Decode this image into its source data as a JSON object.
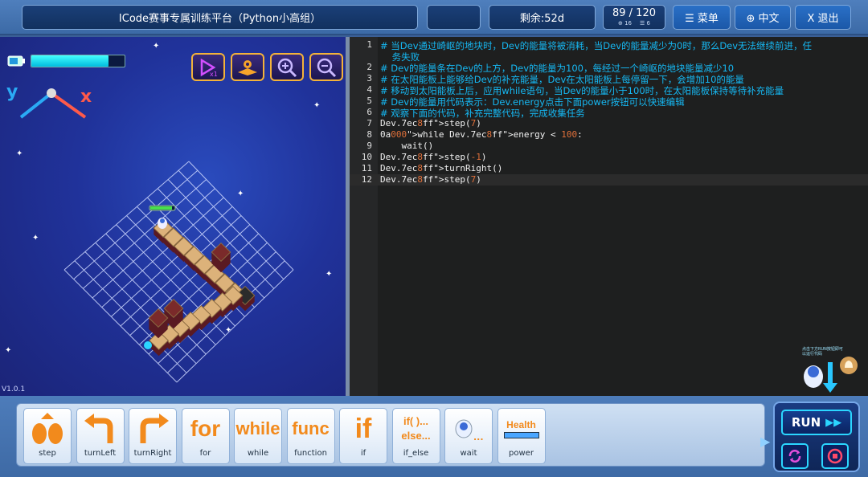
{
  "topbar": {
    "title": "ICode赛事专属训练平台（Python小高组）",
    "remaining": "剩余:52d",
    "progress_main": "89 / 120",
    "progress_sub_a": "⊕ 16",
    "progress_sub_b": "☰ 6",
    "menu_label": "☰ 菜单",
    "lang_label": "⊕ 中文",
    "exit_label": "X 退出"
  },
  "scene": {
    "version": "V1.0.1",
    "axis_y": "y",
    "axis_x": "x",
    "energy_level": 0.83,
    "buttons": [
      "reset-view-icon",
      "map-icon",
      "zoom-in-icon",
      "zoom-out-icon"
    ]
  },
  "editor": {
    "lines": [
      {
        "n": "1",
        "text": "# 当Dev通过崎岖的地块时，Dev的能量将被消耗，当Dev的能量减少为0时，那么Dev无法继续前进，任",
        "kind": "comment"
      },
      {
        "n": "",
        "text": "    务失败",
        "kind": "comment"
      },
      {
        "n": "2",
        "text": "# Dev的能量条在Dev的上方，Dev的能量为100，每经过一个崎岖的地块能量减少10",
        "kind": "comment"
      },
      {
        "n": "3",
        "text": "# 在太阳能板上能够给Dev的补充能量，Dev在太阳能板上每停留一下，会增加10的能量",
        "kind": "comment"
      },
      {
        "n": "4",
        "text": "# 移动到太阳能板上后，应用while语句，当Dev的能量小于100时，在太阳能板保持等待补充能量",
        "kind": "comment"
      },
      {
        "n": "5",
        "text": "# Dev的能量用代码表示：Dev.energy点击下面power按钮可以快速编辑",
        "kind": "comment"
      },
      {
        "n": "6",
        "text": "# 观察下面的代码，补充完整代码，完成收集任务",
        "kind": "comment"
      },
      {
        "n": "7",
        "text": "Dev.step(7)",
        "kind": "code"
      },
      {
        "n": "8",
        "text": "while Dev.energy < 100:",
        "kind": "code"
      },
      {
        "n": "9",
        "text": "    wait()",
        "kind": "code"
      },
      {
        "n": "10",
        "text": "Dev.step(-1)",
        "kind": "code"
      },
      {
        "n": "11",
        "text": "Dev.turnRight()",
        "kind": "code"
      },
      {
        "n": "12",
        "text": "Dev.step(7)",
        "kind": "code"
      }
    ]
  },
  "blocks": [
    {
      "label": "step",
      "icon": "step-icon"
    },
    {
      "label": "turnLeft",
      "icon": "turn-left-icon"
    },
    {
      "label": "turnRight",
      "icon": "turn-right-icon"
    },
    {
      "label": "for",
      "icon": "for-icon",
      "glyph": "for"
    },
    {
      "label": "while",
      "icon": "while-icon",
      "glyph": "while"
    },
    {
      "label": "function",
      "icon": "function-icon",
      "glyph": "func"
    },
    {
      "label": "if",
      "icon": "if-icon",
      "glyph": "if"
    },
    {
      "label": "if_else",
      "icon": "if-else-icon",
      "glyph": "if( )...\nelse..."
    },
    {
      "label": "wait",
      "icon": "wait-icon"
    },
    {
      "label": "power",
      "icon": "power-icon",
      "glyph": "Health"
    }
  ],
  "run": {
    "label": "RUN",
    "hint": "点击下方RUN按钮即可以运行代码"
  },
  "colors": {
    "comment": "#16b8f3",
    "keyword": "#e0a000",
    "number": "#e0703a",
    "accent": "#2bd6ff"
  }
}
